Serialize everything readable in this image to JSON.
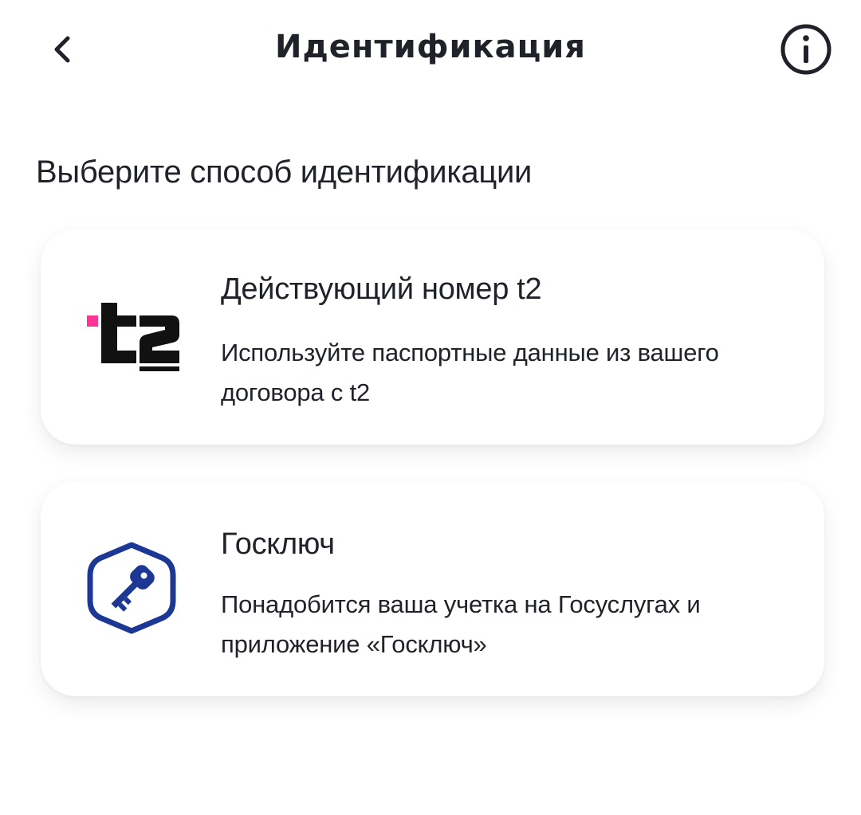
{
  "header": {
    "title": "Идентификация",
    "back_icon": "chevron-left-icon",
    "info_icon": "info-icon"
  },
  "subtitle": "Выберите способ идентификации",
  "options": [
    {
      "title": "Действующий номер t2",
      "description": "Используйте паспортные данные из вашего договора с t2",
      "logo": "t2-logo",
      "logo_text": "t2",
      "logo_accent_color": "#ff3495"
    },
    {
      "title": "Госключ",
      "description": "Понадобится ваша учетка на Госуслугах и приложение «Госключ»",
      "logo": "goskey-logo",
      "logo_color": "#1d3795"
    }
  ],
  "colors": {
    "text": "#1f2229",
    "background": "#ffffff"
  }
}
